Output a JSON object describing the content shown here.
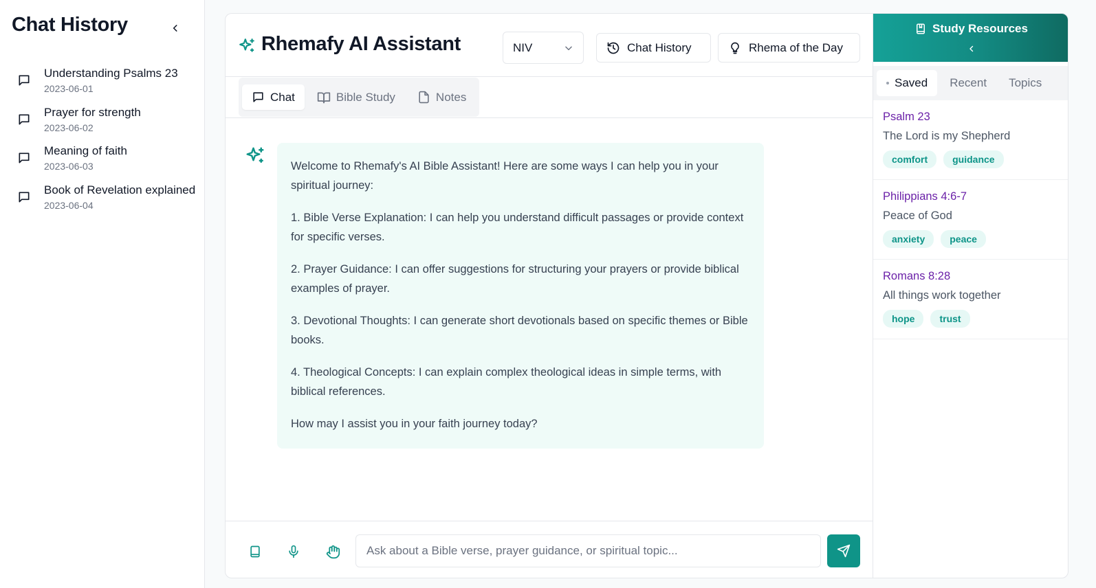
{
  "sidebar": {
    "title": "Chat History",
    "items": [
      {
        "title": "Understanding Psalms 23",
        "date": "2023-06-01"
      },
      {
        "title": "Prayer for strength",
        "date": "2023-06-02"
      },
      {
        "title": "Meaning of faith",
        "date": "2023-06-03"
      },
      {
        "title": "Book of Revelation explained",
        "date": "2023-06-04"
      }
    ]
  },
  "header": {
    "title": "Rhemafy AI Assistant",
    "version_selected": "NIV",
    "chat_history_label": "Chat History",
    "rhema_label": "Rhema of the Day"
  },
  "tabs": [
    {
      "label": "Chat",
      "icon": "message-square-icon",
      "active": true
    },
    {
      "label": "Bible Study",
      "icon": "book-open-icon",
      "active": false
    },
    {
      "label": "Notes",
      "icon": "file-icon",
      "active": false
    }
  ],
  "chat": {
    "messages": [
      {
        "role": "assistant",
        "paragraphs": [
          "Welcome to Rhemafy's AI Bible Assistant! Here are some ways I can help you in your spiritual journey:",
          "1. Bible Verse Explanation: I can help you understand difficult passages or provide context for specific verses.",
          "2. Prayer Guidance: I can offer suggestions for structuring your prayers or provide biblical examples of prayer.",
          "3. Devotional Thoughts: I can generate short devotionals based on specific themes or Bible books.",
          "4. Theological Concepts: I can explain complex theological ideas in simple terms, with biblical references.",
          "How may I assist you in your faith journey today?"
        ]
      }
    ]
  },
  "input": {
    "placeholder": "Ask about a Bible verse, prayer guidance, or spiritual topic...",
    "value": ""
  },
  "resources": {
    "title": "Study Resources",
    "tabs": [
      {
        "label": "Saved",
        "active": true
      },
      {
        "label": "Recent",
        "active": false
      },
      {
        "label": "Topics",
        "active": false
      }
    ],
    "items": [
      {
        "ref": "Psalm 23",
        "subtitle": "The Lord is my Shepherd",
        "tags": [
          "comfort",
          "guidance"
        ]
      },
      {
        "ref": "Philippians 4:6-7",
        "subtitle": "Peace of God",
        "tags": [
          "anxiety",
          "peace"
        ]
      },
      {
        "ref": "Romans 8:28",
        "subtitle": "All things work together",
        "tags": [
          "hope",
          "trust"
        ]
      }
    ]
  },
  "colors": {
    "accent": "#0f9488",
    "resource_ref": "#6b21a8",
    "bubble_bg": "#effbf8"
  }
}
